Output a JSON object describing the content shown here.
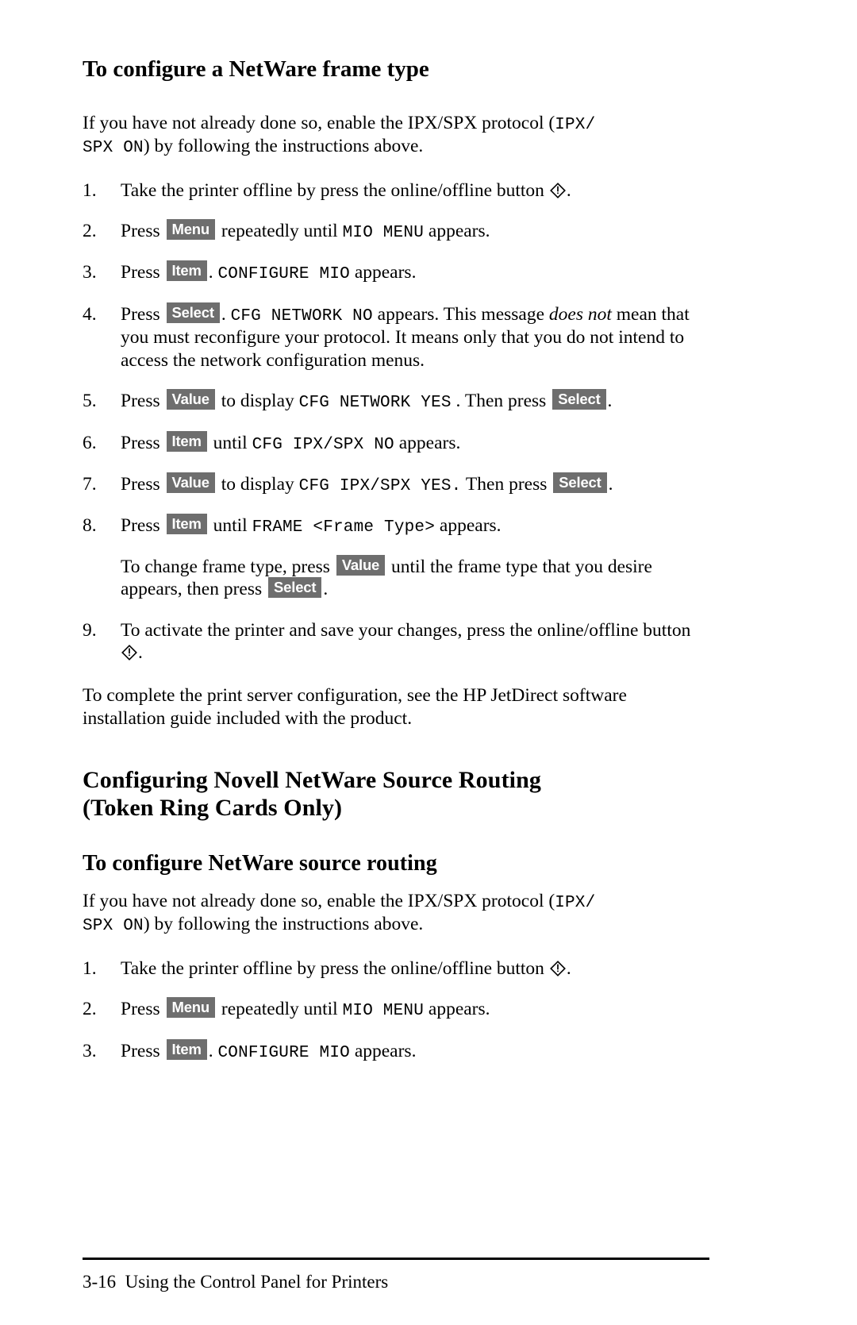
{
  "page": {
    "number_label": "3-16",
    "footer_title": "Using the Control Panel for Printers"
  },
  "icons": {
    "online_offline_button": "diamond-online-offline-icon"
  },
  "keys": {
    "menu": "Menu",
    "item": "Item",
    "select": "Select",
    "value": "Value"
  },
  "section1": {
    "heading": "To configure a NetWare frame type",
    "intro": {
      "part1": "If you have not already done so, enable the IPX/SPX protocol (",
      "mono1": "IPX/",
      "mono2": "SPX ON",
      "part2": ") by following the instructions above."
    },
    "steps": [
      {
        "num": "1.",
        "parts": [
          {
            "type": "text",
            "value": "Take the printer offline by press the online/offline button "
          },
          {
            "type": "icon",
            "value": "diamond-online-offline-icon"
          },
          {
            "type": "text",
            "value": "."
          }
        ]
      },
      {
        "num": "2.",
        "parts": [
          {
            "type": "text",
            "value": "Press "
          },
          {
            "type": "key",
            "value": "Menu"
          },
          {
            "type": "text",
            "value": " repeatedly until "
          },
          {
            "type": "mono",
            "value": "MIO MENU"
          },
          {
            "type": "text",
            "value": " appears."
          }
        ]
      },
      {
        "num": "3.",
        "parts": [
          {
            "type": "text",
            "value": "Press "
          },
          {
            "type": "key",
            "value": "Item"
          },
          {
            "type": "text",
            "value": ". "
          },
          {
            "type": "mono",
            "value": "CONFIGURE MIO"
          },
          {
            "type": "text",
            "value": " appears."
          }
        ]
      },
      {
        "num": "4.",
        "parts": [
          {
            "type": "text",
            "value": "Press "
          },
          {
            "type": "key",
            "value": "Select"
          },
          {
            "type": "text",
            "value": ". "
          },
          {
            "type": "mono",
            "value": "CFG NETWORK NO"
          },
          {
            "type": "text",
            "value": " appears. This message "
          },
          {
            "type": "italic",
            "value": "does not"
          },
          {
            "type": "text",
            "value": " mean that you must reconfigure your protocol. It means only that you do not intend to access the network configuration menus."
          }
        ]
      },
      {
        "num": "5.",
        "parts": [
          {
            "type": "text",
            "value": "Press "
          },
          {
            "type": "key",
            "value": "Value"
          },
          {
            "type": "text",
            "value": " to display "
          },
          {
            "type": "mono",
            "value": "CFG NETWORK YES"
          },
          {
            "type": "text",
            "value": " . Then press "
          },
          {
            "type": "key",
            "value": "Select"
          },
          {
            "type": "text",
            "value": "."
          }
        ]
      },
      {
        "num": "6.",
        "parts": [
          {
            "type": "text",
            "value": "Press "
          },
          {
            "type": "key",
            "value": "Item"
          },
          {
            "type": "text",
            "value": " until "
          },
          {
            "type": "mono",
            "value": "CFG IPX/SPX NO"
          },
          {
            "type": "text",
            "value": " appears."
          }
        ]
      },
      {
        "num": "7.",
        "parts": [
          {
            "type": "text",
            "value": "Press "
          },
          {
            "type": "key",
            "value": "Value"
          },
          {
            "type": "text",
            "value": " to display "
          },
          {
            "type": "mono",
            "value": "CFG IPX/SPX YES."
          },
          {
            "type": "text",
            "value": " Then press "
          },
          {
            "type": "key",
            "value": "Select"
          },
          {
            "type": "text",
            "value": "."
          }
        ]
      },
      {
        "num": "8.",
        "parts": [
          {
            "type": "text",
            "value": "Press "
          },
          {
            "type": "key",
            "value": "Item"
          },
          {
            "type": "text",
            "value": " until "
          },
          {
            "type": "mono",
            "value": "FRAME <Frame Type>"
          },
          {
            "type": "text",
            "value": " appears."
          }
        ],
        "substep": [
          {
            "type": "text",
            "value": "To change frame type, press "
          },
          {
            "type": "key",
            "value": "Value"
          },
          {
            "type": "text",
            "value": " until the frame type that you desire appears, then press "
          },
          {
            "type": "key",
            "value": "Select"
          },
          {
            "type": "text",
            "value": "."
          }
        ]
      },
      {
        "num": "9.",
        "parts": [
          {
            "type": "text",
            "value": "To activate the printer and save your changes, press the online/offline button "
          },
          {
            "type": "icon",
            "value": "diamond-online-offline-icon"
          },
          {
            "type": "text",
            "value": "."
          }
        ]
      }
    ],
    "closing": "To complete the print server configuration, see the HP JetDirect software installation guide included with the product."
  },
  "section2": {
    "heading_line1": "Configuring Novell NetWare Source Routing",
    "heading_line2": "(Token Ring Cards Only)",
    "subheading": "To configure NetWare source routing",
    "intro": {
      "part1": "If you have not already done so, enable the IPX/SPX protocol (",
      "mono1": "IPX/",
      "mono2": "SPX ON",
      "part2": ") by following the instructions above."
    },
    "steps": [
      {
        "num": "1.",
        "parts": [
          {
            "type": "text",
            "value": "Take the printer offline by press the online/offline button "
          },
          {
            "type": "icon",
            "value": "diamond-online-offline-icon"
          },
          {
            "type": "text",
            "value": "."
          }
        ]
      },
      {
        "num": "2.",
        "parts": [
          {
            "type": "text",
            "value": "Press "
          },
          {
            "type": "key",
            "value": "Menu"
          },
          {
            "type": "text",
            "value": " repeatedly until "
          },
          {
            "type": "mono",
            "value": "MIO MENU"
          },
          {
            "type": "text",
            "value": " appears."
          }
        ]
      },
      {
        "num": "3.",
        "parts": [
          {
            "type": "text",
            "value": "Press "
          },
          {
            "type": "key",
            "value": "Item"
          },
          {
            "type": "text",
            "value": ". "
          },
          {
            "type": "mono",
            "value": "CONFIGURE MIO"
          },
          {
            "type": "text",
            "value": " appears."
          }
        ]
      }
    ]
  },
  "colors": {
    "key_background": "#6e6e6e",
    "key_text": "#ffffff",
    "body_text": "#000000",
    "page_background": "#ffffff"
  }
}
